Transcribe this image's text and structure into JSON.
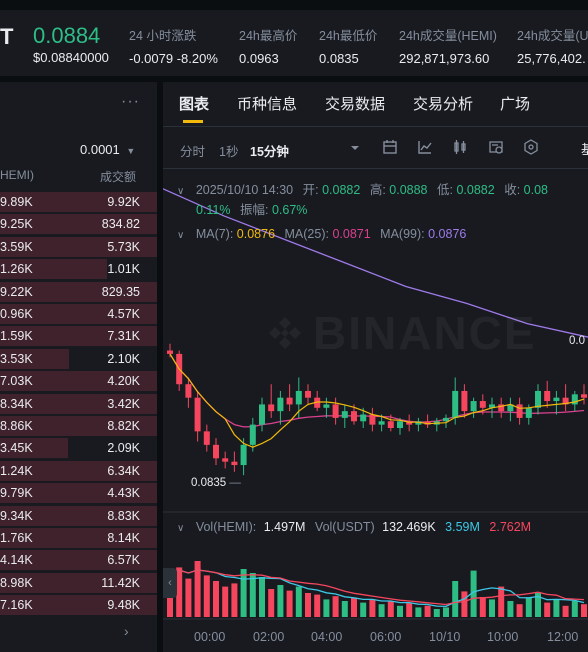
{
  "header": {
    "pair_fragment": "T",
    "last_price": "0.0884",
    "last_price_usd": "$0.08840000",
    "stats": [
      {
        "label": "24 小时涨跌",
        "value": "-0.0079 -8.20%",
        "color": "red"
      },
      {
        "label": "24h最高价",
        "value": "0.0963",
        "color": "default"
      },
      {
        "label": "24h最低价",
        "value": "0.0835",
        "color": "default"
      },
      {
        "label": "24h成交量(HEMI)",
        "value": "292,871,973.60",
        "color": "default"
      },
      {
        "label": "24h成交量(U",
        "value": "25,776,402.",
        "color": "default"
      }
    ]
  },
  "order_book": {
    "more_icon": "ellipsis-icon",
    "tick_size": "0.0001",
    "col_amount": "HEMI)",
    "col_total": "成交额",
    "rows": [
      {
        "amount": "9.89K",
        "total": "9.92K",
        "depth": 1.0
      },
      {
        "amount": "9.25K",
        "total": "834.82",
        "depth": 1.0
      },
      {
        "amount": "3.59K",
        "total": "5.73K",
        "depth": 1.0
      },
      {
        "amount": "1.26K",
        "total": "1.01K",
        "depth": 0.68
      },
      {
        "amount": "9.22K",
        "total": "829.35",
        "depth": 1.0
      },
      {
        "amount": "0.96K",
        "total": "4.57K",
        "depth": 1.0
      },
      {
        "amount": "1.59K",
        "total": "7.31K",
        "depth": 1.0
      },
      {
        "amount": "3.53K",
        "total": "2.10K",
        "depth": 0.44
      },
      {
        "amount": "7.03K",
        "total": "4.20K",
        "depth": 1.0
      },
      {
        "amount": "8.34K",
        "total": "3.42K",
        "depth": 1.0
      },
      {
        "amount": "8.86K",
        "total": "8.82K",
        "depth": 1.0
      },
      {
        "amount": "3.45K",
        "total": "2.09K",
        "depth": 0.43
      },
      {
        "amount": "1.24K",
        "total": "6.34K",
        "depth": 1.0
      },
      {
        "amount": "9.79K",
        "total": "4.43K",
        "depth": 1.0
      },
      {
        "amount": "9.34K",
        "total": "8.83K",
        "depth": 1.0
      },
      {
        "amount": "1.76K",
        "total": "8.14K",
        "depth": 1.0
      },
      {
        "amount": "4.14K",
        "total": "6.57K",
        "depth": 1.0
      },
      {
        "amount": "8.98K",
        "total": "11.42K",
        "depth": 1.0
      },
      {
        "amount": "7.16K",
        "total": "9.48K",
        "depth": 1.0
      }
    ]
  },
  "chart_panel": {
    "tabs": [
      "图表",
      "币种信息",
      "交易数据",
      "交易分析",
      "广场"
    ],
    "active_tab": 0,
    "intervals": [
      "分时",
      "1秒",
      "15分钟"
    ],
    "active_interval": 2,
    "toolbar_icons": [
      "chevron-down-icon",
      "calendar-icon",
      "line-chart-icon",
      "candlestick-icon",
      "indicator-settings-icon",
      "settings-hex-icon"
    ],
    "right_fragment": "基",
    "ohlc": {
      "datetime": "2025/10/10 14:30",
      "open_label": "开:",
      "open": "0.0882",
      "high_label": "高:",
      "high": "0.0888",
      "low_label": "低:",
      "low": "0.0882",
      "close_label": "收:",
      "close": "0.08",
      "change": "0.11%",
      "amp_label": "振幅:",
      "amp": "0.67%"
    },
    "ma": {
      "ma7_label": "MA(7):",
      "ma7": "0.0876",
      "ma7_color": "#f0b90b",
      "ma25_label": "MA(25):",
      "ma25": "0.0871",
      "ma25_color": "#d9418e",
      "ma99_label": "MA(99):",
      "ma99": "0.0876",
      "ma99_color": "#9f7aea"
    },
    "volume": {
      "label_hemi": "Vol(HEMI):",
      "hemi": "1.497M",
      "label_usdt": "Vol(USDT)",
      "usdt": "132.469K",
      "ma1": "3.59M",
      "ma1_color": "#3cc8e6",
      "ma2": "2.762M",
      "ma2_color": "#f6465d"
    },
    "watermark": "BINANCE",
    "low_marker": "0.0835",
    "right_marker": "0.0",
    "x_ticks": [
      "00:00",
      "02:00",
      "04:00",
      "06:00",
      "10/10",
      "10:00",
      "12:00"
    ],
    "colors": {
      "up": "#2ebd85",
      "down": "#f6465d",
      "accent": "#f0b90b"
    }
  },
  "chart_data": {
    "type": "candlestick",
    "interval": "15m",
    "x_ticks": [
      "00:00",
      "02:00",
      "04:00",
      "06:00",
      "10/10",
      "10:00",
      "12:00"
    ],
    "candles": [
      [
        0.0872,
        0.0874,
        0.087,
        0.0871
      ],
      [
        0.0871,
        0.0872,
        0.086,
        0.0862
      ],
      [
        0.0862,
        0.0864,
        0.0855,
        0.0858
      ],
      [
        0.0858,
        0.086,
        0.0845,
        0.0848
      ],
      [
        0.0848,
        0.085,
        0.0842,
        0.0844
      ],
      [
        0.0844,
        0.0846,
        0.0838,
        0.084
      ],
      [
        0.084,
        0.0842,
        0.0837,
        0.0839
      ],
      [
        0.0839,
        0.0842,
        0.0836,
        0.0838
      ],
      [
        0.0838,
        0.0846,
        0.0835,
        0.0844
      ],
      [
        0.0844,
        0.0852,
        0.0842,
        0.085
      ],
      [
        0.085,
        0.0858,
        0.0848,
        0.0856
      ],
      [
        0.0856,
        0.0862,
        0.0852,
        0.0854
      ],
      [
        0.0854,
        0.086,
        0.085,
        0.0858
      ],
      [
        0.0858,
        0.0862,
        0.0854,
        0.0856
      ],
      [
        0.0856,
        0.0864,
        0.0852,
        0.086
      ],
      [
        0.086,
        0.0862,
        0.0856,
        0.0858
      ],
      [
        0.0858,
        0.086,
        0.0854,
        0.0855
      ],
      [
        0.0855,
        0.0858,
        0.0852,
        0.0856
      ],
      [
        0.0856,
        0.0858,
        0.085,
        0.0852
      ],
      [
        0.0852,
        0.0856,
        0.0849,
        0.0854
      ],
      [
        0.0854,
        0.0856,
        0.085,
        0.0851
      ],
      [
        0.0851,
        0.0855,
        0.0849,
        0.0853
      ],
      [
        0.0853,
        0.0855,
        0.0848,
        0.085
      ],
      [
        0.085,
        0.0853,
        0.0848,
        0.0851
      ],
      [
        0.0851,
        0.0853,
        0.0848,
        0.0849
      ],
      [
        0.0849,
        0.0852,
        0.0847,
        0.0851
      ],
      [
        0.0851,
        0.0853,
        0.0848,
        0.085
      ],
      [
        0.085,
        0.0852,
        0.0848,
        0.0851
      ],
      [
        0.0851,
        0.0853,
        0.0849,
        0.085
      ],
      [
        0.085,
        0.0852,
        0.0848,
        0.0851
      ],
      [
        0.0851,
        0.0853,
        0.0849,
        0.0852
      ],
      [
        0.0852,
        0.0864,
        0.085,
        0.086
      ],
      [
        0.086,
        0.0862,
        0.0852,
        0.0854
      ],
      [
        0.0854,
        0.0858,
        0.0852,
        0.0857
      ],
      [
        0.0857,
        0.0859,
        0.0853,
        0.0855
      ],
      [
        0.0855,
        0.0858,
        0.0852,
        0.0856
      ],
      [
        0.0856,
        0.0858,
        0.0852,
        0.0854
      ],
      [
        0.0854,
        0.0858,
        0.0851,
        0.0856
      ],
      [
        0.0856,
        0.0858,
        0.085,
        0.0852
      ],
      [
        0.0852,
        0.0856,
        0.085,
        0.0855
      ],
      [
        0.0855,
        0.0862,
        0.0853,
        0.086
      ],
      [
        0.086,
        0.0863,
        0.0855,
        0.0857
      ],
      [
        0.0857,
        0.086,
        0.0853,
        0.0858
      ],
      [
        0.0858,
        0.0862,
        0.0854,
        0.0856
      ],
      [
        0.0856,
        0.086,
        0.0854,
        0.0859
      ],
      [
        0.0859,
        0.0862,
        0.0856,
        0.0858
      ]
    ],
    "volume_scale": [
      0.55,
      0.62,
      0.48,
      0.7,
      0.52,
      0.45,
      0.38,
      0.42,
      0.6,
      0.55,
      0.5,
      0.35,
      0.4,
      0.33,
      0.38,
      0.3,
      0.28,
      0.22,
      0.26,
      0.2,
      0.24,
      0.18,
      0.22,
      0.16,
      0.2,
      0.14,
      0.18,
      0.12,
      0.14,
      0.1,
      0.12,
      0.45,
      0.32,
      0.58,
      0.25,
      0.22,
      0.38,
      0.2,
      0.16,
      0.24,
      0.3,
      0.18,
      0.22,
      0.14,
      0.2,
      0.16
    ],
    "ma99_curve": [
      0.092,
      0.0912,
      0.0905,
      0.0898,
      0.0891,
      0.0886,
      0.088,
      0.0876
    ],
    "ylim": [
      0.083,
      0.0925
    ]
  }
}
